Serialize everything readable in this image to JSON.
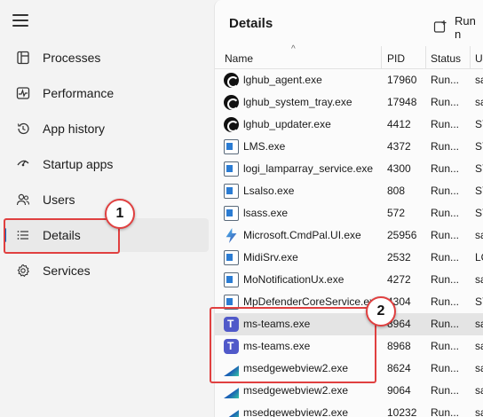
{
  "sidebar": {
    "items": [
      {
        "label": "Processes",
        "icon": "processes-icon"
      },
      {
        "label": "Performance",
        "icon": "performance-icon"
      },
      {
        "label": "App history",
        "icon": "history-icon"
      },
      {
        "label": "Startup apps",
        "icon": "startup-icon"
      },
      {
        "label": "Users",
        "icon": "users-icon"
      },
      {
        "label": "Details",
        "icon": "details-icon",
        "selected": true
      },
      {
        "label": "Services",
        "icon": "gear-icon"
      }
    ]
  },
  "main": {
    "title": "Details",
    "run_label": "Run n"
  },
  "table": {
    "columns": [
      "Name",
      "PID",
      "Status",
      "U"
    ],
    "rows": [
      {
        "name": "lghub_agent.exe",
        "pid": "17960",
        "status": "Run...",
        "user": "sa",
        "icon": "logitech-icon"
      },
      {
        "name": "lghub_system_tray.exe",
        "pid": "17948",
        "status": "Run...",
        "user": "sa",
        "icon": "logitech-icon"
      },
      {
        "name": "lghub_updater.exe",
        "pid": "4412",
        "status": "Run...",
        "user": "SY",
        "icon": "logitech-icon"
      },
      {
        "name": "LMS.exe",
        "pid": "4372",
        "status": "Run...",
        "user": "SY",
        "icon": "app-icon"
      },
      {
        "name": "logi_lamparray_service.exe",
        "pid": "4300",
        "status": "Run...",
        "user": "SY",
        "icon": "app-icon"
      },
      {
        "name": "Lsalso.exe",
        "pid": "808",
        "status": "Run...",
        "user": "SY",
        "icon": "app-icon"
      },
      {
        "name": "lsass.exe",
        "pid": "572",
        "status": "Run...",
        "user": "SY",
        "icon": "app-icon"
      },
      {
        "name": "Microsoft.CmdPal.UI.exe",
        "pid": "25956",
        "status": "Run...",
        "user": "sa",
        "icon": "cmdpal-icon"
      },
      {
        "name": "MidiSrv.exe",
        "pid": "2532",
        "status": "Run...",
        "user": "LO",
        "icon": "app-icon"
      },
      {
        "name": "MoNotificationUx.exe",
        "pid": "4272",
        "status": "Run...",
        "user": "sa",
        "icon": "app-icon"
      },
      {
        "name": "MpDefenderCoreService.exe",
        "pid": "4304",
        "status": "Run...",
        "user": "SY",
        "icon": "app-icon"
      },
      {
        "name": "ms-teams.exe",
        "pid": "8964",
        "status": "Run...",
        "user": "sa",
        "icon": "teams-icon",
        "highlight": true
      },
      {
        "name": "ms-teams.exe",
        "pid": "8968",
        "status": "Run...",
        "user": "sa",
        "icon": "teams-icon"
      },
      {
        "name": "msedgewebview2.exe",
        "pid": "8624",
        "status": "Run...",
        "user": "sa",
        "icon": "edge-icon"
      },
      {
        "name": "msedgewebview2.exe",
        "pid": "9064",
        "status": "Run...",
        "user": "sa",
        "icon": "edge-icon"
      },
      {
        "name": "msedgewebview2.exe",
        "pid": "10232",
        "status": "Run...",
        "user": "sa",
        "icon": "edge-icon"
      }
    ]
  },
  "callouts": {
    "one": "1",
    "two": "2"
  },
  "colors": {
    "callout": "#e04040",
    "accent": "#0067c0"
  }
}
